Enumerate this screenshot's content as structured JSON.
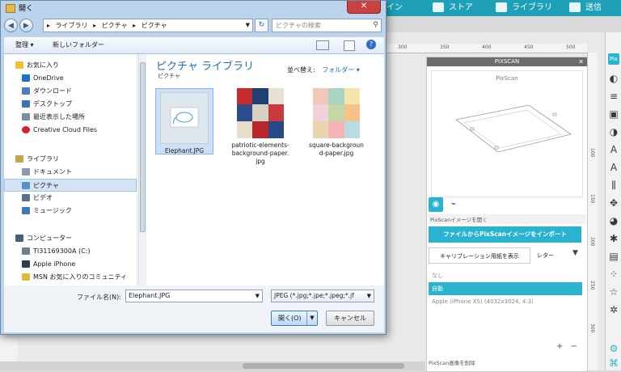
{
  "app": {
    "tabs": [
      {
        "label": "イン",
        "icon": "heart-icon"
      },
      {
        "label": "ストア",
        "icon": "s-logo-icon"
      },
      {
        "label": "ライブラリ",
        "icon": "download-icon"
      },
      {
        "label": "送信",
        "icon": "cutter-icon"
      }
    ],
    "ruler_top": [
      "300",
      "350",
      "400",
      "450",
      "500"
    ],
    "ruler_side": [
      "100",
      "150",
      "200",
      "250",
      "300"
    ],
    "pixscan": {
      "title": "PIXSCAN",
      "preview_label": "PixScan",
      "open_label": "PixScanイメージを開く",
      "import_button": "ファイルからPixScanイメージをインポート",
      "calibration_button": "キャリブレーション用紙を表示",
      "paper_size": "レター",
      "camera_options": [
        "なし",
        "自動",
        "Apple (iPhone XS) (4032x3024, 4:3)"
      ],
      "selected_camera_index": 1,
      "plus": "+",
      "minus": "−",
      "delete_label": "PixScan画像を削除"
    },
    "accent_color": "#29b3cf"
  },
  "dialog": {
    "title": "開く",
    "close": "✕",
    "address": [
      "ライブラリ",
      "ピクチャ",
      "ピクチャ"
    ],
    "search_placeholder": "ピクチャの検索",
    "toolbar": {
      "organize": "整理 ▾",
      "new_folder": "新しいフォルダー"
    },
    "nav": [
      {
        "label": "お気に入り",
        "icon": "star-icon",
        "color": "#f0c030",
        "level": 0
      },
      {
        "label": "OneDrive",
        "icon": "cloud-icon",
        "color": "#1c6fd1",
        "level": 1
      },
      {
        "label": "ダウンロード",
        "icon": "download-folder-icon",
        "color": "#4a7fc4",
        "level": 1
      },
      {
        "label": "デスクトップ",
        "icon": "desktop-icon",
        "color": "#3b6fb6",
        "level": 1
      },
      {
        "label": "最近表示した場所",
        "icon": "recent-places-icon",
        "color": "#7d8aa0",
        "level": 1
      },
      {
        "label": "Creative Cloud Files",
        "icon": "creative-cloud-icon",
        "color": "#da1f26",
        "level": 1
      },
      {
        "label": "ライブラリ",
        "icon": "library-icon",
        "color": "#c9a54a",
        "level": 0
      },
      {
        "label": "ドキュメント",
        "icon": "documents-icon",
        "color": "#8a9bb0",
        "level": 1
      },
      {
        "label": "ピクチャ",
        "icon": "pictures-icon",
        "color": "#5b8fc8",
        "level": 1,
        "selected": true
      },
      {
        "label": "ビデオ",
        "icon": "video-icon",
        "color": "#5b6f8c",
        "level": 1
      },
      {
        "label": "ミュージック",
        "icon": "music-icon",
        "color": "#3f77c2",
        "level": 1
      },
      {
        "label": "コンピューター",
        "icon": "computer-icon",
        "color": "#4b5f7c",
        "level": 0
      },
      {
        "label": "TI31169300A (C:)",
        "icon": "drive-icon",
        "color": "#6e7f95",
        "level": 1
      },
      {
        "label": "Apple iPhone",
        "icon": "phone-icon",
        "color": "#2f3b4f",
        "level": 1
      },
      {
        "label": "MSN お気に入りのコミュニティ",
        "icon": "folder-icon",
        "color": "#e2b93b",
        "level": 1
      }
    ],
    "library_title": "ピクチャ ライブラリ",
    "library_subtitle": "ピクチャ",
    "arrange_label": "並べ替え:",
    "arrange_value": "フォルダー ▾",
    "files": [
      {
        "name": "Elephant.JPG",
        "selected": true
      },
      {
        "name": "patriotic-elements-background-paper.jpg",
        "selected": false
      },
      {
        "name": "square-background-paper.jpg",
        "selected": false
      }
    ],
    "filename_label": "ファイル名(N):",
    "filename_value": "Elephant.JPG",
    "filetype_value": "JPEG (*.jpg;*.jpe;*.jpeg;*.jf",
    "open_button": "開く(O)",
    "cancel_button": "キャンセル"
  }
}
